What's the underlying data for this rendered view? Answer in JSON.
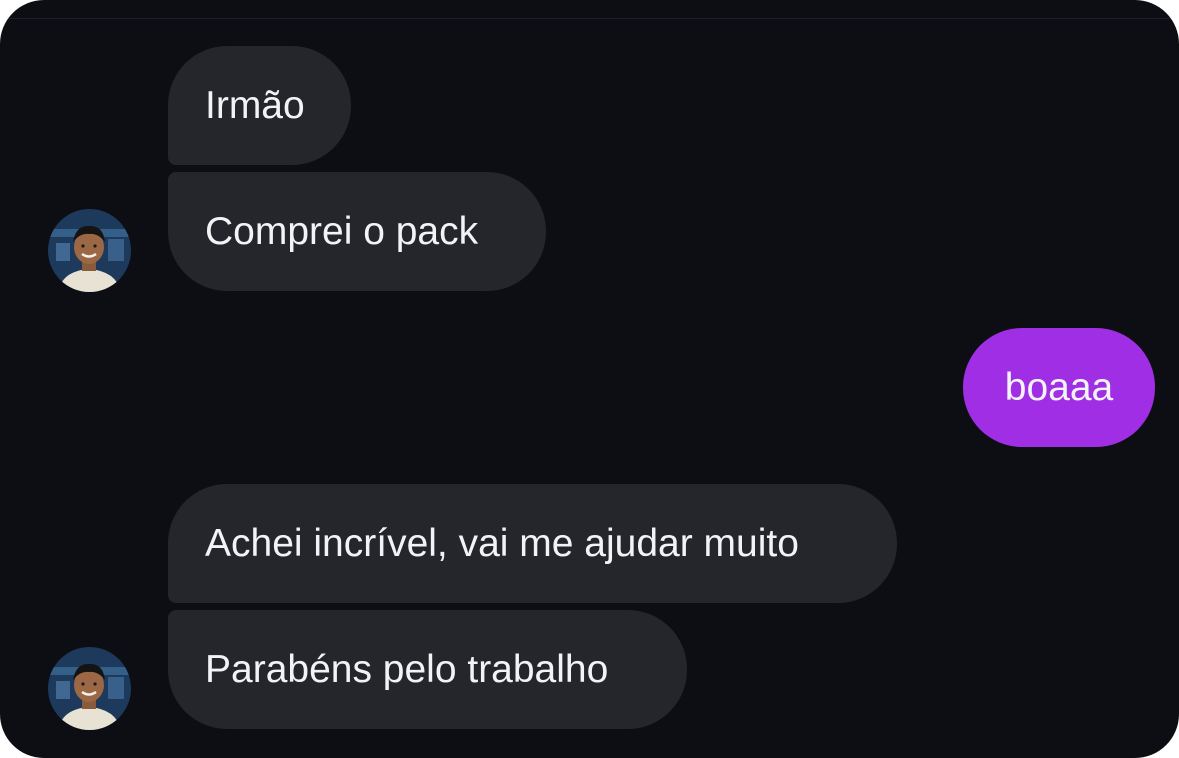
{
  "conversation": {
    "incoming_group_1": {
      "msg_1": "Irmão",
      "msg_2": "Comprei o pack"
    },
    "outgoing_group_1": {
      "msg_1": "boaaa"
    },
    "incoming_group_2": {
      "msg_1": "Achei incrível, vai me ajudar muito",
      "msg_2": "Parabéns pelo trabalho"
    }
  },
  "colors": {
    "background": "#0c0e13",
    "incoming_bubble": "#24262b",
    "outgoing_bubble": "#a02ee4",
    "text": "#f2f3f5"
  }
}
